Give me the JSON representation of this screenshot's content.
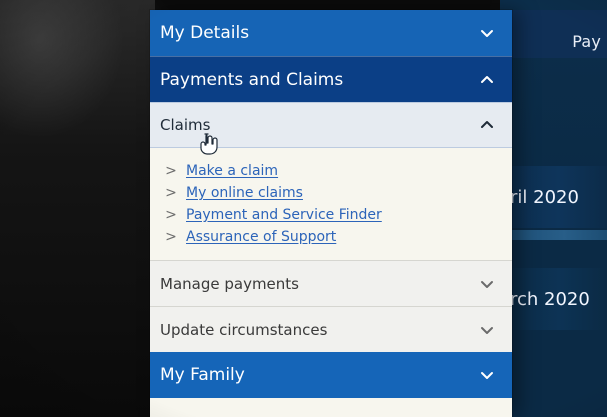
{
  "colors": {
    "menu_blue": "#1664b5",
    "menu_blue_dark": "#0b3f86",
    "link_blue": "#2c64b9",
    "light_row": "#e6ebf1",
    "page_bg": "#f7f6ee",
    "right_bg": "#0b2a45"
  },
  "menu": {
    "top_sections": [
      {
        "label": "My Details",
        "expanded": false,
        "icon": "chevron-down-icon"
      },
      {
        "label": "Payments and Claims",
        "expanded": true,
        "icon": "chevron-up-icon"
      }
    ],
    "claims": {
      "label": "Claims",
      "expanded": true,
      "icon": "chevron-up-icon",
      "links": [
        {
          "label": "Make a claim"
        },
        {
          "label": "My online claims"
        },
        {
          "label": "Payment and Service Finder"
        },
        {
          "label": "Assurance of Support"
        }
      ]
    },
    "other_sections": [
      {
        "label": "Manage payments",
        "expanded": false,
        "icon": "chevron-down-icon"
      },
      {
        "label": "Update circumstances",
        "expanded": false,
        "icon": "chevron-down-icon"
      }
    ],
    "bottom_section": {
      "label": "My Family",
      "expanded": false,
      "icon": "chevron-down-icon"
    }
  },
  "right_panel": {
    "top_text": "Pay",
    "card1_text": "ril 2020",
    "card2_text": "rch 2020"
  },
  "cursor": {
    "icon": "hand-pointer-icon"
  }
}
